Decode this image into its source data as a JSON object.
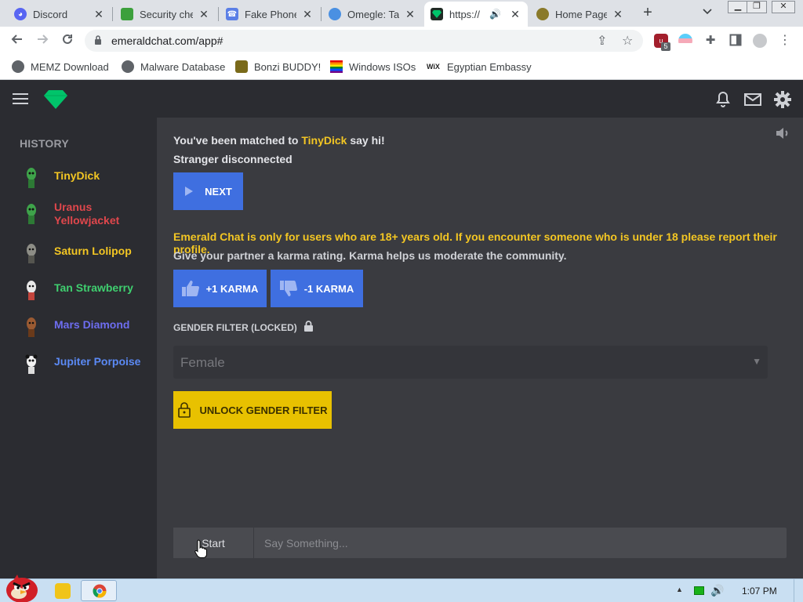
{
  "browser": {
    "tabs": [
      {
        "title": "Discord",
        "favicon": "discord-icon",
        "color": "#5865f2"
      },
      {
        "title": "Security che",
        "favicon": "shield-leaf-icon",
        "color": "#3ca03c"
      },
      {
        "title": "Fake Phone",
        "favicon": "phone-icon",
        "color": "#5b7fe6"
      },
      {
        "title": "Omegle: Tal",
        "favicon": "omegle-icon",
        "color": "#4a90e2"
      },
      {
        "title": "https://",
        "favicon": "emerald-icon",
        "color": "#00c46a",
        "active": true
      },
      {
        "title": "Home Page",
        "favicon": "bonzi-icon",
        "color": "#8a7a2a"
      }
    ],
    "url": "emeraldchat.com/app#",
    "bookmarks": [
      {
        "label": "MEMZ Download",
        "icon": "globe-icon"
      },
      {
        "label": "Malware Database",
        "icon": "globe-icon"
      },
      {
        "label": "Bonzi BUDDY!",
        "icon": "bonzi-icon"
      },
      {
        "label": "Windows ISOs",
        "icon": "rainbow-flag-icon"
      },
      {
        "label": "Egyptian Embassy",
        "icon": "wix-icon"
      }
    ],
    "extension_badge": "5"
  },
  "sidebar": {
    "title": "HISTORY",
    "items": [
      {
        "name": "TinyDick",
        "color": "#f3c623",
        "avatar": "green-alien-avatar"
      },
      {
        "name": "Uranus Yellowjacket",
        "color": "#e0474c",
        "avatar": "green-alien-avatar"
      },
      {
        "name": "Saturn Lolipop",
        "color": "#f3c623",
        "avatar": "gray-face-avatar"
      },
      {
        "name": "Tan Strawberry",
        "color": "#3fcf6f",
        "avatar": "white-face-avatar"
      },
      {
        "name": "Mars Diamond",
        "color": "#6d6df0",
        "avatar": "brown-face-avatar"
      },
      {
        "name": "Jupiter Porpoise",
        "color": "#5b8af5",
        "avatar": "panda-avatar"
      }
    ]
  },
  "main": {
    "match_prefix": "You've been matched to ",
    "match_name": "TinyDick",
    "match_suffix": " say hi!",
    "disconnected": "Stranger disconnected",
    "next_label": "NEXT",
    "age_warning": "Emerald Chat is only for users who are 18+ years old. If you encounter someone who is under 18 please report their profile.",
    "karma_note": "Give your partner a karma rating. Karma helps us moderate the community.",
    "plus_karma": "+1 KARMA",
    "minus_karma": "-1 KARMA",
    "gender_label": "GENDER FILTER (LOCKED)",
    "gender_value": "Female",
    "unlock_label": "UNLOCK GENDER FILTER",
    "start_label": "Start",
    "chat_placeholder": "Say Something..."
  },
  "taskbar": {
    "clock": "1:07 PM"
  },
  "colors": {
    "accent_blue": "#3f6fe0",
    "accent_yellow": "#e8c100",
    "highlight": "#f3c623",
    "emerald": "#00c46a"
  }
}
